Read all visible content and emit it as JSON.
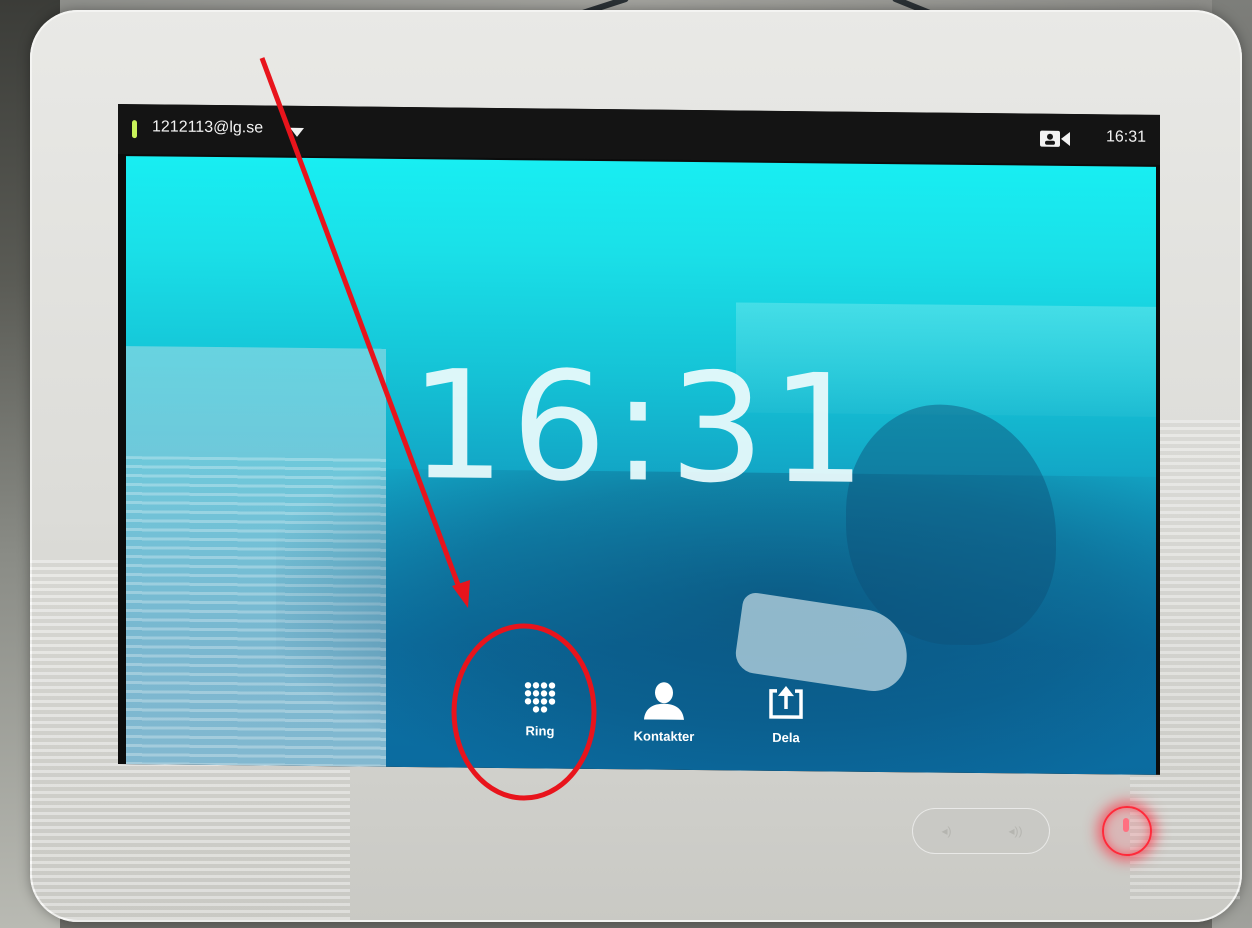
{
  "status_bar": {
    "account": "1212113@lg.se",
    "time": "16:31",
    "camera_icon": "camera-icon",
    "caret_icon": "caret-down-icon"
  },
  "home": {
    "clock": "16:31"
  },
  "actions": [
    {
      "label": "Ring",
      "icon": "dialpad-icon"
    },
    {
      "label": "Kontakter",
      "icon": "person-icon"
    },
    {
      "label": "Dela",
      "icon": "share-icon"
    }
  ],
  "device_buttons": {
    "volume_down_icon": "volume-down-icon",
    "volume_up_icon": "volume-up-icon",
    "mute_icon": "microphone-icon"
  },
  "annotation": {
    "color": "#e8141c"
  },
  "colors": {
    "status_indicator": "#c9f25a",
    "mute_glow": "#ff2a3a",
    "screen_top": "#18eef2",
    "screen_bottom": "#0b6b9f"
  }
}
